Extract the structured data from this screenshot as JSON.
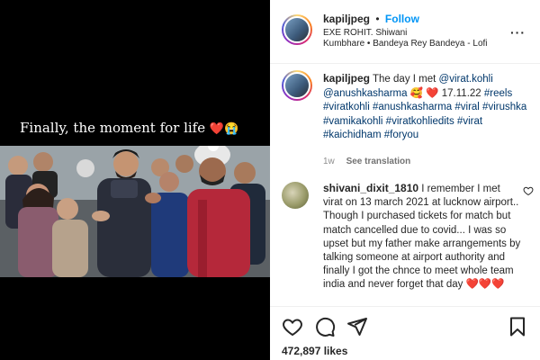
{
  "video": {
    "overlay_text": "Finally, the moment for life",
    "overlay_emoji": "❤️😭"
  },
  "header": {
    "username": "kapiljpeg",
    "separator": "•",
    "follow_label": "Follow",
    "location": "EXE ROHIT. Shiwani",
    "audio": "Kumbhare • Bandeya Rey Bandeya - Lofi",
    "more_icon": "more-options-icon"
  },
  "caption": {
    "username": "kapiljpeg",
    "text_start": "The day I met",
    "mention_1": "@virat.kohli",
    "mention_2": "@anushkasharma",
    "emoji": "🥰",
    "heart": "❤️",
    "date": "17.11.22",
    "hashtags": "#reels #viratkohli #anushkasharma #viral #virushka #vamikakohli #viratkohliedits #virat #kaichidham #foryou",
    "time_ago": "1w",
    "see_translation": "See translation"
  },
  "comment": {
    "username": "shivani_dixit_1810",
    "text": "I remember I met virat on 13 march 2021 at lucknow airport.. Though I purchased tickets for match but match cancelled due to covid... I was so upset but my father make arrangements by talking someone at airport authority and finally I got the chnce to meet whole team india and never forget that day",
    "hearts": "❤️❤️❤️",
    "like_icon": "heart-outline-icon"
  },
  "actions": {
    "like_icon": "heart-outline-icon",
    "comment_icon": "comment-bubble-icon",
    "share_icon": "paper-plane-icon",
    "save_icon": "bookmark-icon",
    "likes": "472,897 likes"
  }
}
